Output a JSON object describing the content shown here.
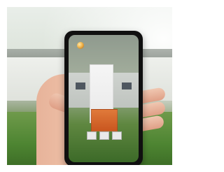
{
  "image": {
    "subject": "hand-holding-phone",
    "notes": ""
  }
}
